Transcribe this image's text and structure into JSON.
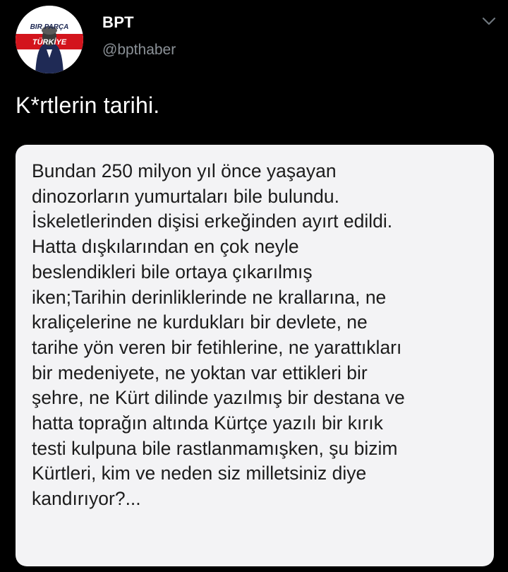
{
  "account": {
    "name": "BPT",
    "handle": "@bpthaber",
    "avatar_text": "BIR PARÇA",
    "avatar_subtext": "TÜRKİYE",
    "avatar_colors": {
      "background": "#ffffff",
      "red": "#d3141c",
      "navy": "#1f2a55"
    }
  },
  "menu_icon": "chevron-down-icon",
  "tweet": {
    "text": "K*rtlerin tarihi."
  },
  "image_card": {
    "lines": [
      "Bundan 250 milyon yıl önce yaşayan",
      "dinozorların yumurtaları bile bulundu.",
      "İskeletlerinden dişisi erkeğinden ayırt edildi.",
      "Hatta dışkılarından en çok neyle",
      "beslendikleri bile ortaya çıkarılmış",
      "iken;Tarihin derinliklerinde ne krallarına, ne",
      "kraliçelerine ne kurdukları bir devlete, ne",
      "tarihe yön veren bir fetihlerine, ne yarattıkları",
      "bir medeniyete, ne yoktan var ettikleri bir",
      "şehre, ne Kürt dilinde yazılmış bir destana ve",
      "hatta toprağın altında Kürtçe yazılı bir kırık",
      "testi kulpuna bile rastlanmamışken, şu bizim",
      "Kürtleri, kim ve neden siz milletsiniz diye",
      "kandırıyor?..."
    ]
  },
  "colors": {
    "page_background": "#000000",
    "handle_gray": "#8b9197",
    "card_background": "#f3f3f5",
    "card_text": "#1c1c1c"
  }
}
